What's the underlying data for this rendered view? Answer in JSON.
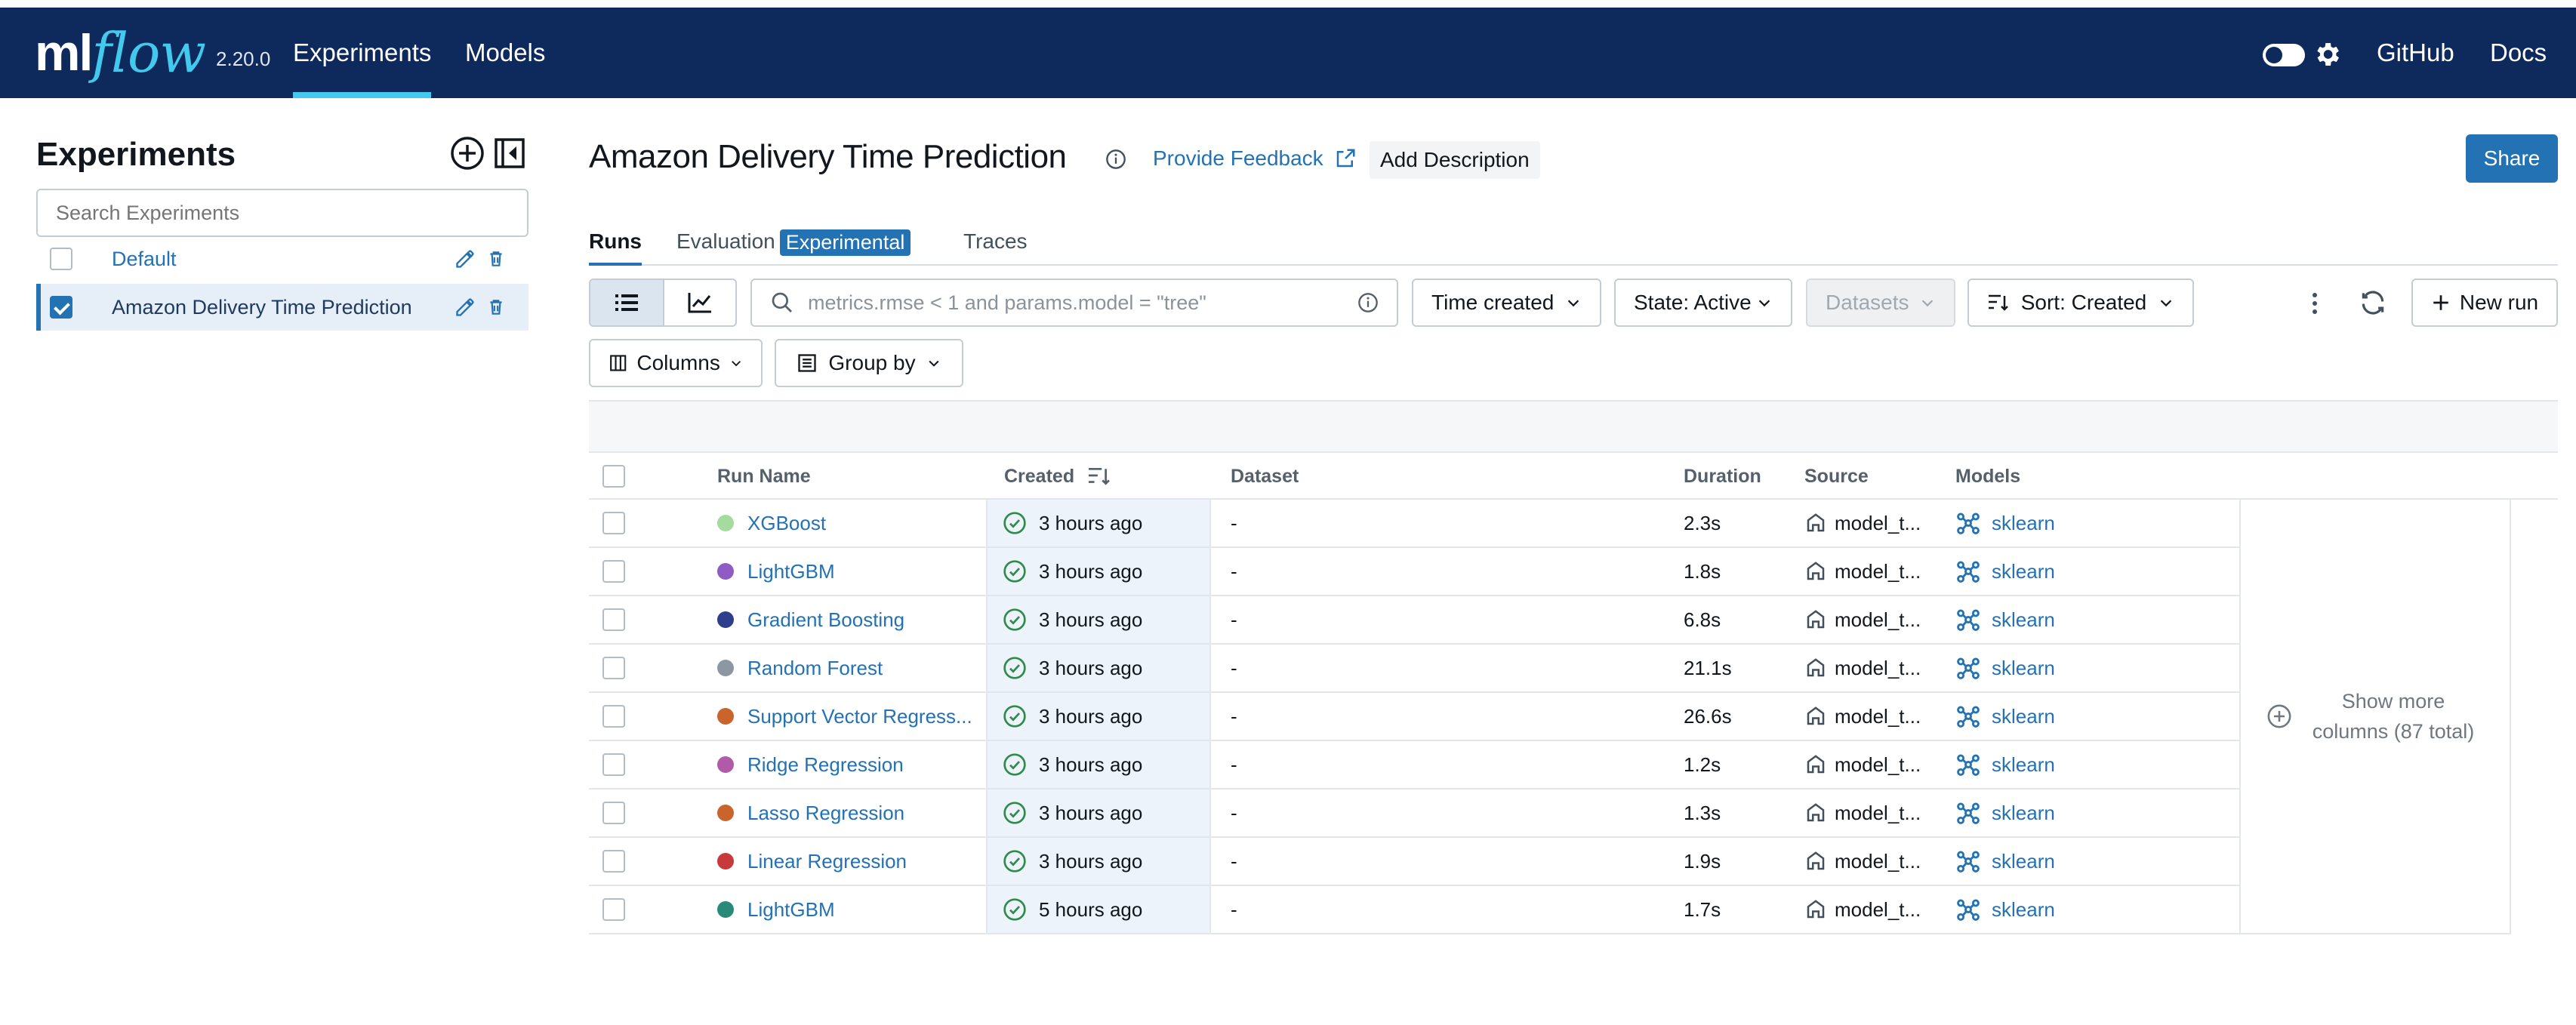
{
  "header": {
    "logo_ml": "ml",
    "logo_flow": "flow",
    "version": "2.20.0",
    "nav": [
      "Experiments",
      "Models"
    ],
    "links": [
      "GitHub",
      "Docs"
    ]
  },
  "sidebar": {
    "title": "Experiments",
    "search_placeholder": "Search Experiments",
    "items": [
      {
        "label": "Default",
        "checked": false
      },
      {
        "label": "Amazon Delivery Time Prediction",
        "checked": true
      }
    ]
  },
  "experiment": {
    "title": "Amazon Delivery Time Prediction",
    "feedback": "Provide Feedback",
    "add_description": "Add Description",
    "share": "Share"
  },
  "tabs": {
    "runs": "Runs",
    "evaluation": "Evaluation",
    "experimental": "Experimental",
    "traces": "Traces"
  },
  "toolbar": {
    "search_placeholder": "metrics.rmse < 1 and params.model = \"tree\"",
    "time_created": "Time created",
    "state": "State: Active",
    "datasets": "Datasets",
    "sort": "Sort: Created",
    "new_run": "New run",
    "columns": "Columns",
    "group_by": "Group by"
  },
  "table": {
    "columns": [
      "Run Name",
      "Created",
      "Dataset",
      "Duration",
      "Source",
      "Models"
    ],
    "rows": [
      {
        "name": "XGBoost",
        "color": "#a6dba0",
        "created": "3 hours ago",
        "dataset": "-",
        "duration": "2.3s",
        "source": "model_t...",
        "model": "sklearn"
      },
      {
        "name": "LightGBM",
        "color": "#8e5cc4",
        "created": "3 hours ago",
        "dataset": "-",
        "duration": "1.8s",
        "source": "model_t...",
        "model": "sklearn"
      },
      {
        "name": "Gradient Boosting",
        "color": "#2c3e8c",
        "created": "3 hours ago",
        "dataset": "-",
        "duration": "6.8s",
        "source": "model_t...",
        "model": "sklearn"
      },
      {
        "name": "Random Forest",
        "color": "#8d97a1",
        "created": "3 hours ago",
        "dataset": "-",
        "duration": "21.1s",
        "source": "model_t...",
        "model": "sklearn"
      },
      {
        "name": "Support Vector Regress...",
        "color": "#c8642c",
        "created": "3 hours ago",
        "dataset": "-",
        "duration": "26.6s",
        "source": "model_t...",
        "model": "sklearn"
      },
      {
        "name": "Ridge Regression",
        "color": "#b05aa8",
        "created": "3 hours ago",
        "dataset": "-",
        "duration": "1.2s",
        "source": "model_t...",
        "model": "sklearn"
      },
      {
        "name": "Lasso Regression",
        "color": "#c8642c",
        "created": "3 hours ago",
        "dataset": "-",
        "duration": "1.3s",
        "source": "model_t...",
        "model": "sklearn"
      },
      {
        "name": "Linear Regression",
        "color": "#c83a3a",
        "created": "3 hours ago",
        "dataset": "-",
        "duration": "1.9s",
        "source": "model_t...",
        "model": "sklearn"
      },
      {
        "name": "LightGBM",
        "color": "#2a8a78",
        "created": "5 hours ago",
        "dataset": "-",
        "duration": "1.7s",
        "source": "model_t...",
        "model": "sklearn"
      }
    ],
    "show_more": "Show more columns (87 total)"
  },
  "colors": {
    "header_bg": "#0e2a5c",
    "accent": "#2272b4",
    "logo_accent": "#43c9ed"
  }
}
